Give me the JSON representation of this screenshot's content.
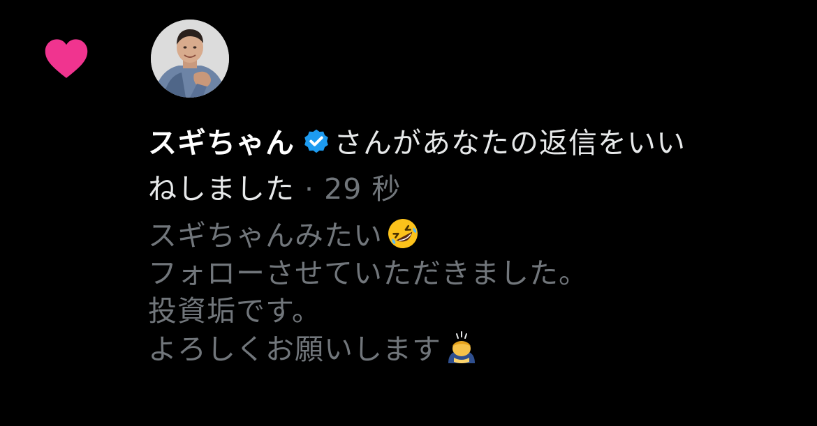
{
  "notification": {
    "user_name": "スギちゃん",
    "action_text_1": "さんがあなたの返信をいい",
    "action_text_2": "ねしました",
    "separator": "·",
    "timestamp": "29 秒",
    "reply_lines": [
      "スギちゃんみたい",
      "フォローさせていただきました。",
      "投資垢です。",
      "よろしくお願いします"
    ],
    "icons": {
      "like": "heart-icon",
      "verified": "verified-badge-icon",
      "emoji_1": "rolling-on-floor-laughing-emoji",
      "emoji_2": "person-bowing-emoji"
    }
  },
  "colors": {
    "background": "#000000",
    "like_pink": "#f91880",
    "verified_blue": "#1d9bf0",
    "primary_text": "#e7e9ea",
    "secondary_text": "#71767b"
  }
}
